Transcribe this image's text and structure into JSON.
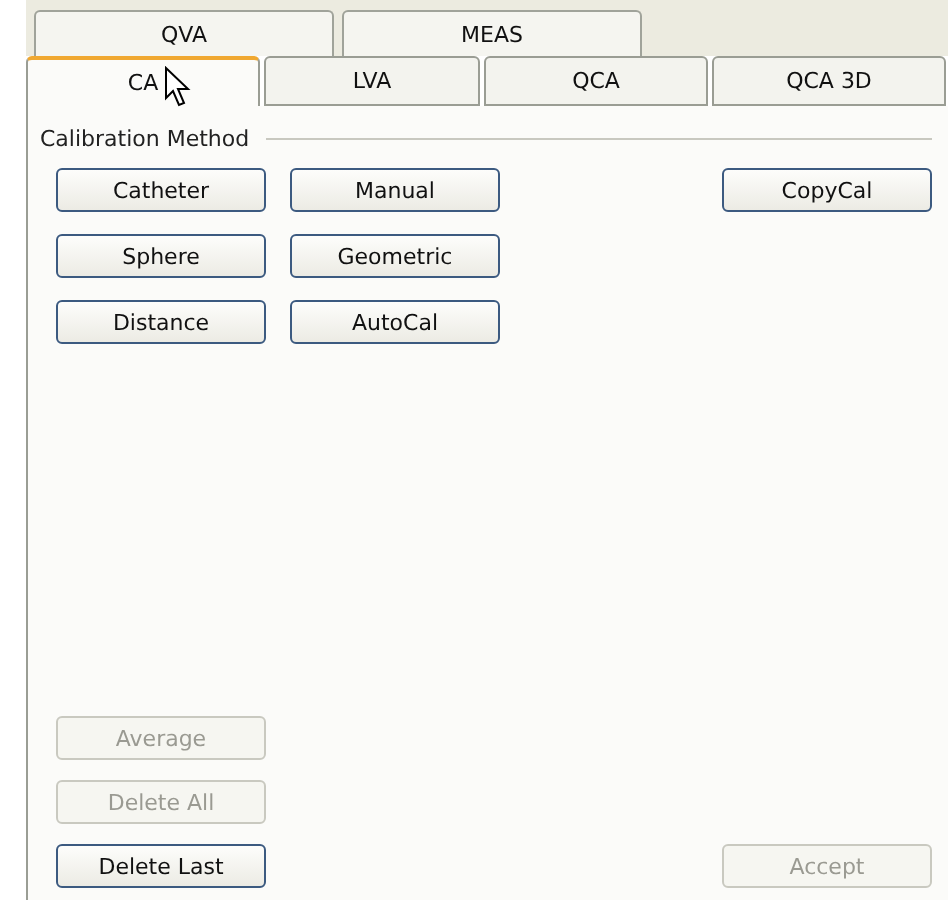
{
  "outer_tabs": [
    {
      "label": "QVA",
      "selected": false
    },
    {
      "label": "MEAS",
      "selected": false
    }
  ],
  "inner_tabs": [
    {
      "label": "CA",
      "selected": true
    },
    {
      "label": "LVA",
      "selected": false
    },
    {
      "label": "QCA",
      "selected": false
    },
    {
      "label": "QCA 3D",
      "selected": false
    }
  ],
  "group": {
    "title": "Calibration Method"
  },
  "method_buttons": [
    [
      {
        "label": "Catheter",
        "disabled": false
      },
      {
        "label": "Manual",
        "disabled": false
      },
      {
        "label": "CopyCal",
        "disabled": false
      }
    ],
    [
      {
        "label": "Sphere",
        "disabled": false
      },
      {
        "label": "Geometric",
        "disabled": false
      }
    ],
    [
      {
        "label": "Distance",
        "disabled": false
      },
      {
        "label": "AutoCal",
        "disabled": false
      }
    ]
  ],
  "bottom_buttons": [
    {
      "label": "Average",
      "disabled": true
    },
    {
      "label": "Delete All",
      "disabled": true
    },
    {
      "label": "Delete Last",
      "disabled": false
    }
  ],
  "accept": {
    "label": "Accept",
    "disabled": true
  }
}
